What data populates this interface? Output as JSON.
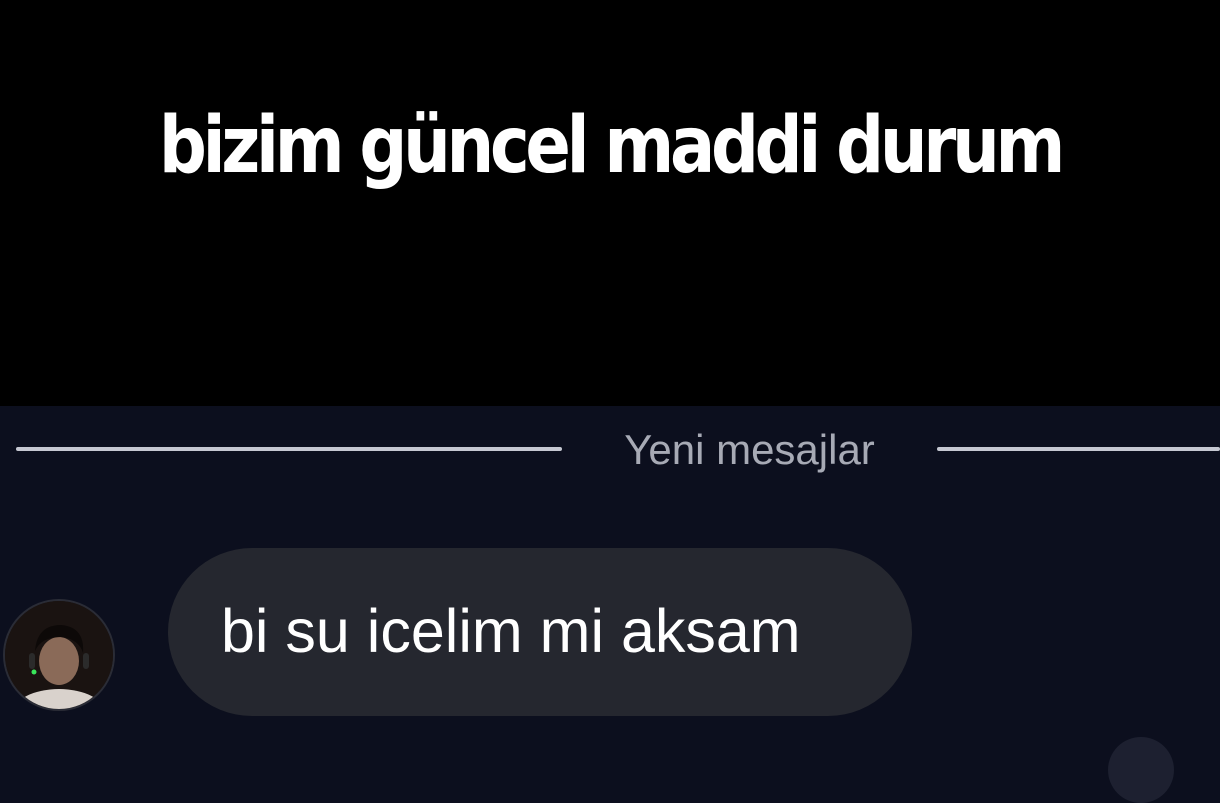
{
  "caption": {
    "text": "bizim güncel maddi durum"
  },
  "chat": {
    "divider_label": "Yeni mesajlar",
    "message": {
      "text": "bi su icelim mi aksam"
    },
    "avatar_icon": "user-photo"
  },
  "colors": {
    "caption_bg": "#000000",
    "chat_bg": "#0c0f1e",
    "bubble_bg": "#25272f",
    "divider": "#c6c8d2",
    "divider_text": "#a7aab5",
    "text": "#ffffff"
  }
}
